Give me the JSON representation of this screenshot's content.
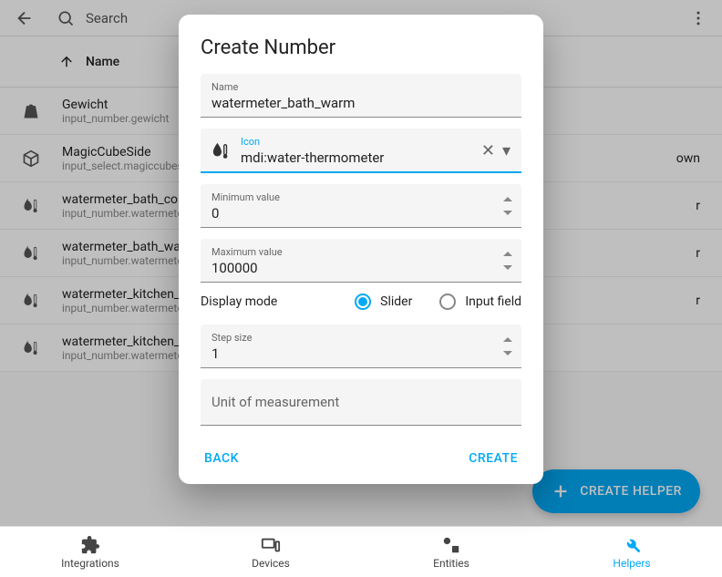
{
  "topbar": {
    "search_placeholder": "Search"
  },
  "header": {
    "name_col": "Name"
  },
  "rows": [
    {
      "title": "Gewicht",
      "sub": "input_number.gewicht",
      "icon": "weight"
    },
    {
      "title": "MagicCubeSide",
      "sub": "input_select.magiccubeside",
      "icon": "cube",
      "extra": "own"
    },
    {
      "title": "watermeter_bath_cold",
      "sub": "input_number.watermeter_bath_cold",
      "icon": "water",
      "extra": "r"
    },
    {
      "title": "watermeter_bath_warm",
      "sub": "input_number.watermeter_bath_warm",
      "icon": "water",
      "extra": "r"
    },
    {
      "title": "watermeter_kitchen_cold",
      "sub": "input_number.watermeter_kitchen_cold",
      "icon": "water",
      "extra": "r"
    },
    {
      "title": "watermeter_kitchen_warm",
      "sub": "input_number.watermeter_kitchen_warm",
      "icon": "water"
    }
  ],
  "fab": {
    "label": "CREATE HELPER"
  },
  "bottomnav": {
    "integrations": "Integrations",
    "devices": "Devices",
    "entities": "Entities",
    "helpers": "Helpers"
  },
  "dialog": {
    "title": "Create Number",
    "name_label": "Name",
    "name_value": "watermeter_bath_warm",
    "icon_label": "Icon",
    "icon_value": "mdi:water-thermometer",
    "min_label": "Minimum value",
    "min_value": "0",
    "max_label": "Maximum value",
    "max_value": "100000",
    "display_mode_label": "Display mode",
    "slider_label": "Slider",
    "input_field_label": "Input field",
    "step_label": "Step size",
    "step_value": "1",
    "uom_placeholder": "Unit of measurement",
    "back": "BACK",
    "create": "CREATE"
  }
}
